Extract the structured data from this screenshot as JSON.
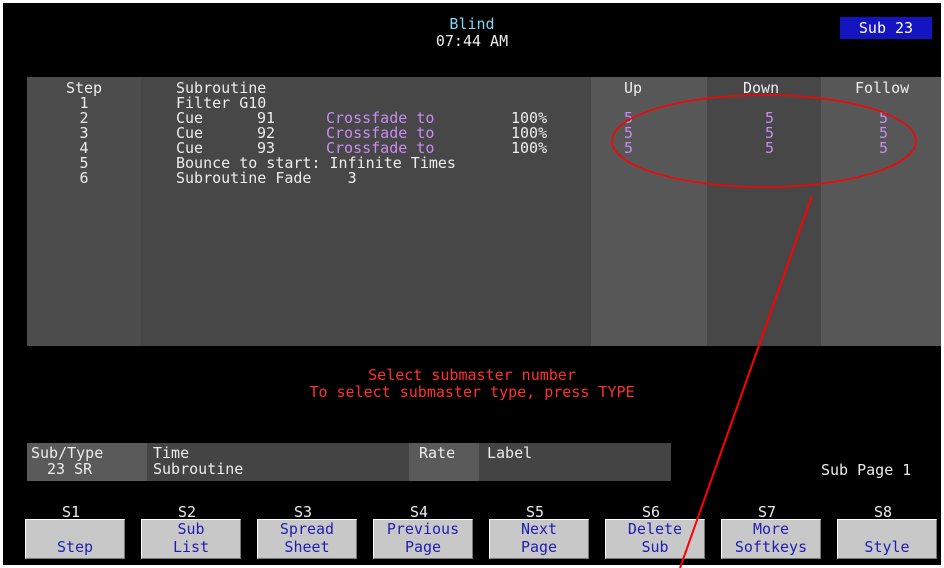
{
  "header": {
    "mode": "Blind",
    "time": "07:44 AM",
    "sub_badge": "Sub 23"
  },
  "table": {
    "headers": {
      "step": "Step",
      "subroutine": "Subroutine",
      "up": "Up",
      "down": "Down",
      "follow": "Follow"
    },
    "rows": [
      {
        "step": "1",
        "text": "Filter G10"
      },
      {
        "step": "2",
        "type": "Cue",
        "num": "91",
        "action": "Crossfade to",
        "level": "100%",
        "up": "5",
        "down": "5",
        "follow": "5"
      },
      {
        "step": "3",
        "type": "Cue",
        "num": "92",
        "action": "Crossfade to",
        "level": "100%",
        "up": "5",
        "down": "5",
        "follow": "5"
      },
      {
        "step": "4",
        "type": "Cue",
        "num": "93",
        "action": "Crossfade to",
        "level": "100%",
        "up": "5",
        "down": "5",
        "follow": "5"
      },
      {
        "step": "5",
        "text": "Bounce to start: Infinite Times"
      },
      {
        "step": "6",
        "text": "Subroutine Fade    3"
      }
    ]
  },
  "prompt": {
    "line1": "Select submaster number",
    "line2": "To select submaster type, press TYPE"
  },
  "info_bar": {
    "subtype_label": "Sub/Type",
    "subtype_value": "23 SR",
    "time_label": "Time",
    "time_value": "Subroutine",
    "rate_label": "Rate",
    "label_label": "Label",
    "sub_page": "Sub Page 1"
  },
  "softkeys": [
    {
      "num": "S1",
      "line1": "",
      "line2": "Step"
    },
    {
      "num": "S2",
      "line1": "Sub",
      "line2": "List"
    },
    {
      "num": "S3",
      "line1": "Spread",
      "line2": "Sheet"
    },
    {
      "num": "S4",
      "line1": "Previous",
      "line2": "Page"
    },
    {
      "num": "S5",
      "line1": "Next",
      "line2": "Page"
    },
    {
      "num": "S6",
      "line1": "Delete",
      "line2": "Sub"
    },
    {
      "num": "S7",
      "line1": "More",
      "line2": "Softkeys"
    },
    {
      "num": "S8",
      "line1": "",
      "line2": "Style"
    }
  ],
  "colors": {
    "badge": "#1414c0",
    "accent_text": "#c98cf2",
    "prompt_text": "#ff3030",
    "annotation": "#ff0000"
  }
}
